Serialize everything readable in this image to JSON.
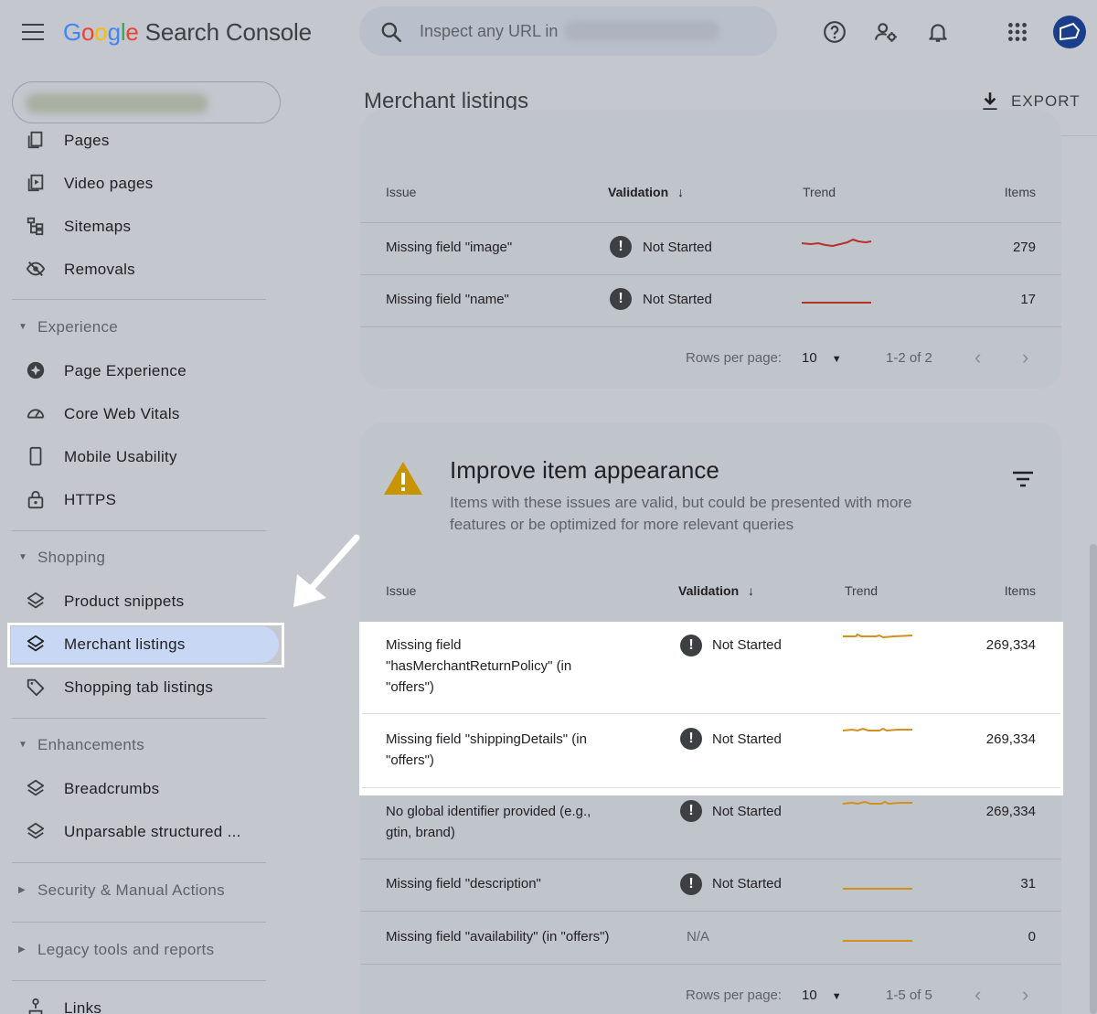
{
  "app": {
    "title_g": [
      "G",
      "o",
      "o",
      "g",
      "l",
      "e"
    ],
    "title_rest": "Search Console"
  },
  "search": {
    "placeholder": "Inspect any URL in"
  },
  "sidebar": {
    "items_top": [
      {
        "label": "Pages",
        "icon": "pages-icon"
      },
      {
        "label": "Video pages",
        "icon": "video-pages-icon"
      },
      {
        "label": "Sitemaps",
        "icon": "sitemap-icon"
      },
      {
        "label": "Removals",
        "icon": "eye-off-icon"
      }
    ],
    "experience": {
      "title": "Experience",
      "items": [
        {
          "label": "Page Experience"
        },
        {
          "label": "Core Web Vitals"
        },
        {
          "label": "Mobile Usability"
        },
        {
          "label": "HTTPS"
        }
      ]
    },
    "shopping": {
      "title": "Shopping",
      "items": [
        {
          "label": "Product snippets"
        },
        {
          "label": "Merchant listings"
        },
        {
          "label": "Shopping tab listings"
        }
      ]
    },
    "enhancements": {
      "title": "Enhancements",
      "items": [
        {
          "label": "Breadcrumbs"
        },
        {
          "label": "Unparsable structured ..."
        }
      ]
    },
    "security": {
      "title": "Security & Manual Actions"
    },
    "legacy": {
      "title": "Legacy tools and reports"
    },
    "links": {
      "label": "Links"
    }
  },
  "main": {
    "title": "Merchant listings",
    "export_label": "EXPORT",
    "table1": {
      "headers": {
        "issue": "Issue",
        "validation": "Validation",
        "trend": "Trend",
        "items": "Items"
      },
      "rows": [
        {
          "issue": "Missing field \"image\"",
          "status": "Not Started",
          "items": "279"
        },
        {
          "issue": "Missing field \"name\"",
          "status": "Not Started",
          "items": "17"
        }
      ],
      "rows_per_page_label": "Rows per page:",
      "rows_per_page": "10",
      "range": "1-2 of 2"
    },
    "table2": {
      "title": "Improve item appearance",
      "desc1": "Items with these issues are valid, but could be presented with more",
      "desc2": "features or be optimized for more relevant queries",
      "headers": {
        "issue": "Issue",
        "validation": "Validation",
        "trend": "Trend",
        "items": "Items"
      },
      "rows": [
        {
          "issue1": "Missing field",
          "issue2": "\"hasMerchantReturnPolicy\" (in",
          "issue3": "\"offers\")",
          "status": "Not Started",
          "items": "269,334"
        },
        {
          "issue1": "Missing field \"shippingDetails\" (in",
          "issue2": "\"offers\")",
          "status": "Not Started",
          "items": "269,334"
        },
        {
          "issue1": "No global identifier provided (e.g.,",
          "issue2": "gtin, brand)",
          "status": "Not Started",
          "items": "269,334"
        },
        {
          "issue1": "Missing field \"description\"",
          "status": "Not Started",
          "items": "31"
        },
        {
          "issue1": "Missing field \"availability\" (in \"offers\")",
          "status": "N/A",
          "items": "0"
        }
      ],
      "rows_per_page_label": "Rows per page:",
      "rows_per_page": "10",
      "range": "1-5 of 5"
    }
  },
  "colors": {
    "trend_red": "#b5312a",
    "trend_orange": "#d4901f",
    "warning": "#c89400"
  }
}
